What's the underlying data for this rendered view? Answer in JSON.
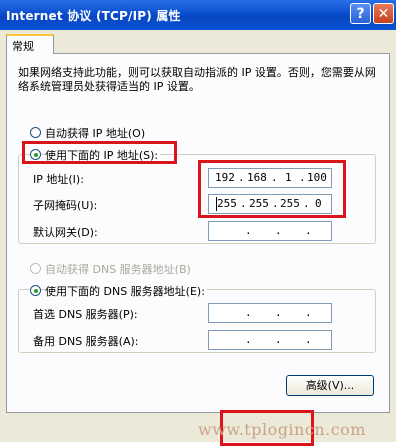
{
  "window": {
    "title": "Internet 协议 (TCP/IP) 属性",
    "help_label": "?",
    "close_label": "✕"
  },
  "tab": {
    "label": "常规"
  },
  "description": "如果网络支持此功能，则可以获取自动指派的 IP 设置。否则，您需要从网络系统管理员处获得适当的 IP 设置。",
  "ip": {
    "auto_label": "自动获得 IP 地址(O)",
    "manual_label": "使用下面的 IP 地址(S):",
    "fields": [
      {
        "label": "IP 地址(I):",
        "octets": [
          "192",
          "168",
          "1",
          "100"
        ]
      },
      {
        "label": "子网掩码(U):",
        "octets": [
          "255",
          "255",
          "255",
          "0"
        ]
      },
      {
        "label": "默认网关(D):",
        "octets": [
          "",
          "",
          "",
          ""
        ]
      }
    ]
  },
  "dns": {
    "auto_label": "自动获得 DNS 服务器地址(B)",
    "manual_label": "使用下面的 DNS 服务器地址(E):",
    "fields": [
      {
        "label": "首选 DNS 服务器(P):",
        "octets": [
          "",
          "",
          "",
          ""
        ]
      },
      {
        "label": "备用 DNS 服务器(A):",
        "octets": [
          "",
          "",
          "",
          ""
        ]
      }
    ]
  },
  "advanced_label": "高级(V)...",
  "watermark": "www.tplogincn.com",
  "colors": {
    "title_bar": "#0a4fd0",
    "highlight": "#d9141b",
    "dialog_bg": "#ece9d8"
  }
}
